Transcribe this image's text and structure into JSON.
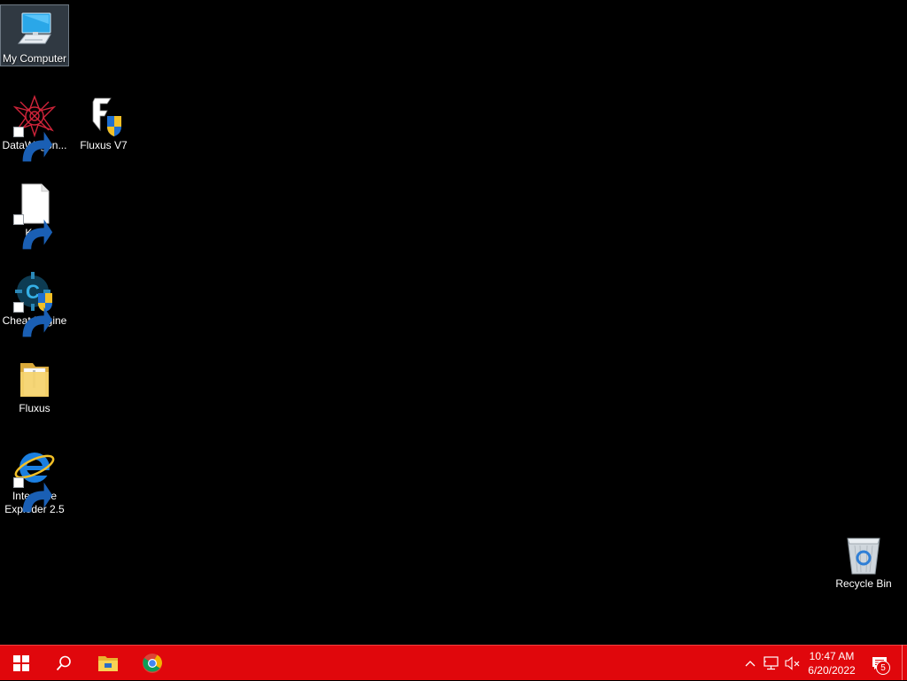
{
  "desktop": {
    "icons": [
      {
        "label": "My Computer",
        "icon": "computer-icon",
        "shortcut": false,
        "selected": true
      },
      {
        "label": "DataWagon...",
        "icon": "datawagon-icon",
        "shortcut": true,
        "selected": false
      },
      {
        "label": "Fluxus V7",
        "icon": "fluxus-exe-icon",
        "shortcut": false,
        "selected": false
      },
      {
        "label": "Krnl",
        "icon": "blank-file-icon",
        "shortcut": true,
        "selected": false
      },
      {
        "label": "Cheat Engine",
        "icon": "cheat-engine-icon",
        "shortcut": true,
        "selected": false
      },
      {
        "label": "Fluxus",
        "icon": "folder-icon",
        "shortcut": false,
        "selected": false
      },
      {
        "label": "Interzone Exploder 2.5",
        "icon": "internet-explorer-icon",
        "shortcut": true,
        "selected": false
      },
      {
        "label": "Recycle Bin",
        "icon": "recycle-bin-icon",
        "shortcut": false,
        "selected": false
      }
    ]
  },
  "taskbar": {
    "color": "#e0070c",
    "pinned": [
      {
        "name": "start-button",
        "icon": "windows-logo-icon"
      },
      {
        "name": "search-button",
        "icon": "search-icon"
      },
      {
        "name": "file-explorer-button",
        "icon": "folder-icon"
      },
      {
        "name": "chrome-button",
        "icon": "chrome-icon"
      }
    ],
    "tray": {
      "icons": [
        "chevron-up-icon",
        "network-icon",
        "volume-muted-icon"
      ],
      "time": "10:47 AM",
      "date": "6/20/2022",
      "notification_count": "5"
    }
  }
}
